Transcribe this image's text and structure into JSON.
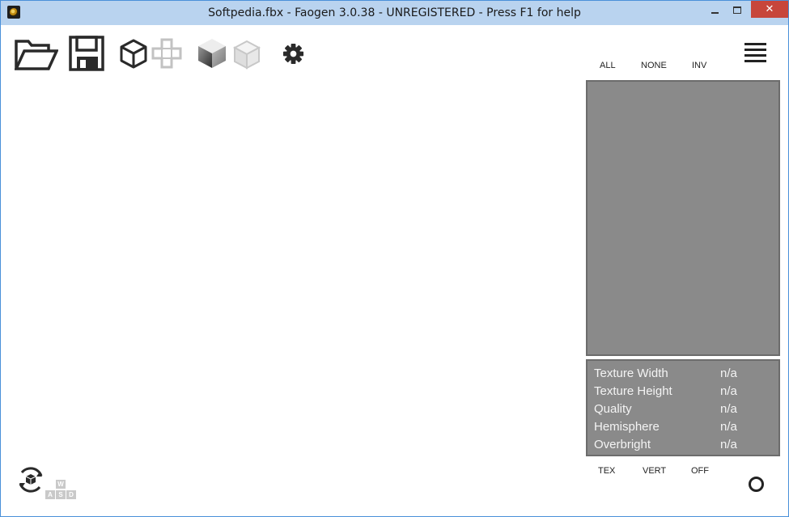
{
  "window": {
    "title": "Softpedia.fbx - Faogen 3.0.38 - UNREGISTERED - Press F1 for help",
    "close_label": "✕",
    "accent": "#b9d3ef"
  },
  "toolbar": {
    "icons": [
      "open-folder-icon",
      "save-disk-icon",
      "cube-outline-icon",
      "cross-outline-icon",
      "cube-shaded-icon",
      "cube-light-icon",
      "gear-icon"
    ]
  },
  "selection": {
    "all": "ALL",
    "none": "NONE",
    "inv": "INV"
  },
  "info": {
    "rows": [
      {
        "label": "Texture Width",
        "value": "n/a"
      },
      {
        "label": "Texture Height",
        "value": "n/a"
      },
      {
        "label": "Quality",
        "value": "n/a"
      },
      {
        "label": "Hemisphere",
        "value": "n/a"
      },
      {
        "label": "Overbright",
        "value": "n/a"
      }
    ]
  },
  "modes": {
    "tex": "TEX",
    "vert": "VERT",
    "off": "OFF"
  },
  "keys": {
    "w": "W",
    "a": "A",
    "s": "S",
    "d": "D"
  },
  "colors": {
    "panel": "#8a8a8a",
    "close": "#c7463b"
  }
}
